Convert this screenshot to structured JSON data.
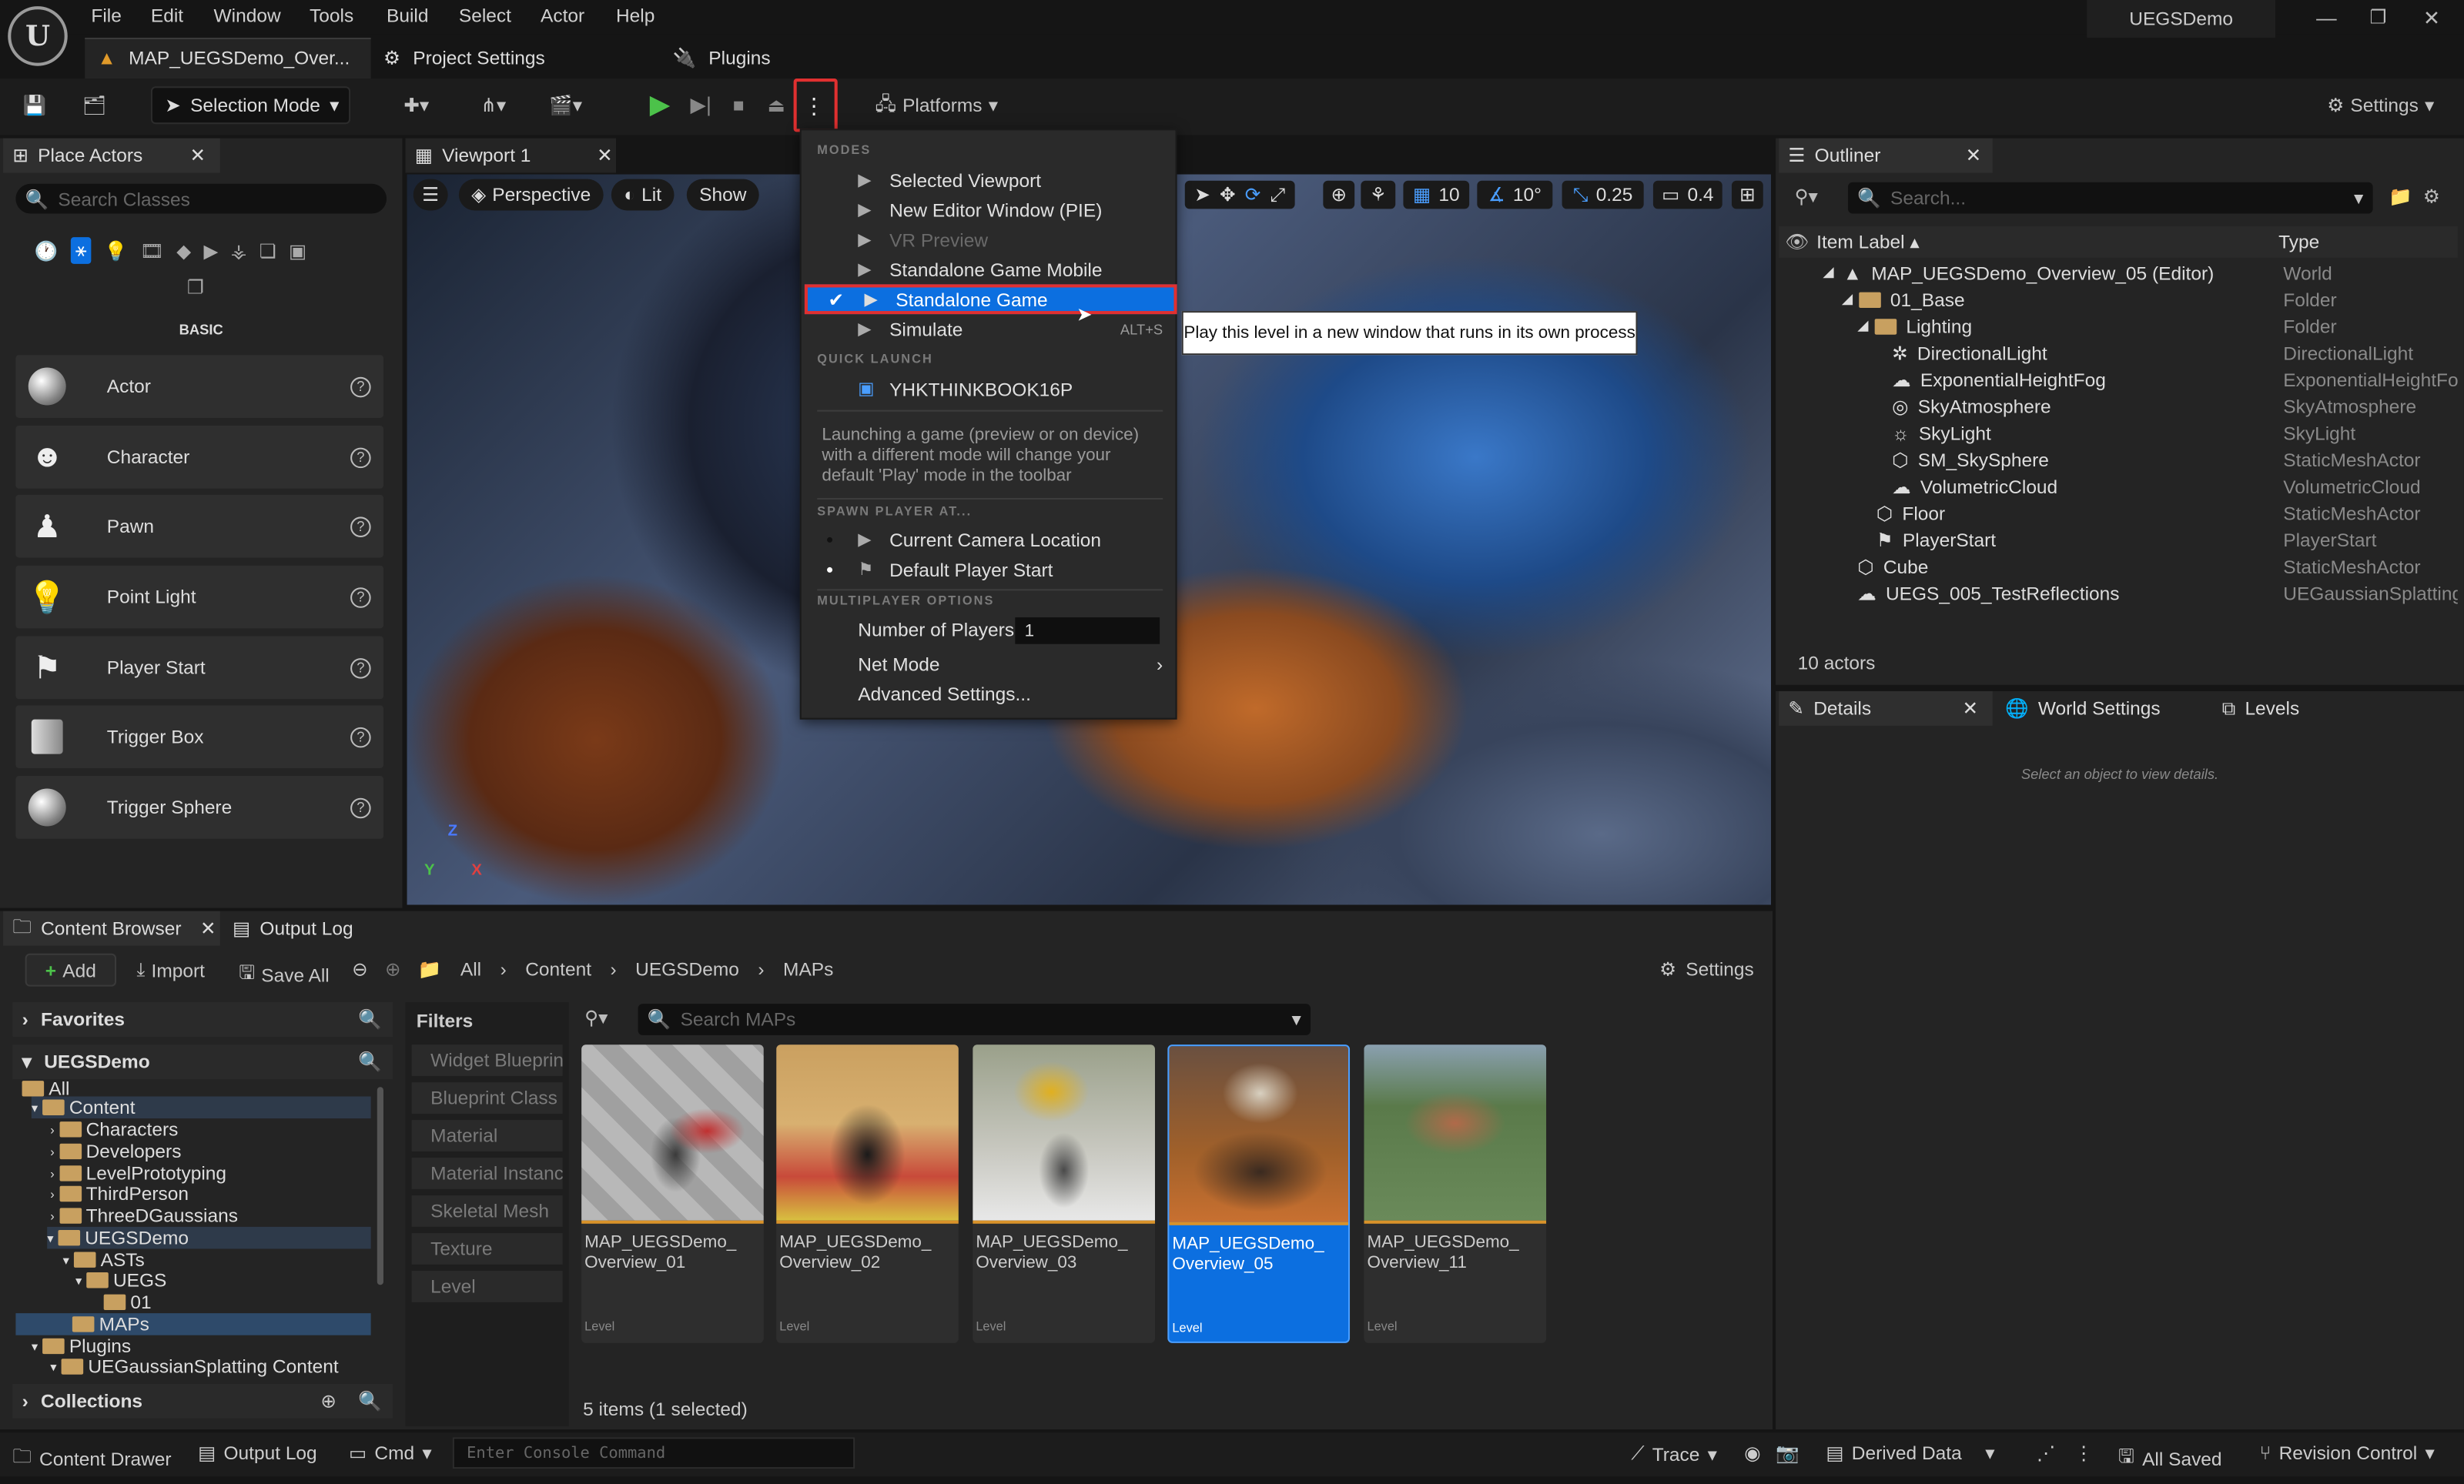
{
  "menubar": {
    "items": [
      "File",
      "Edit",
      "Window",
      "Tools",
      "Build",
      "Select",
      "Actor",
      "Help"
    ],
    "project_name": "UEGSDemo"
  },
  "tabs": {
    "level_tab": "MAP_UEGSDemo_Over...",
    "project_settings": "Project Settings",
    "plugins": "Plugins"
  },
  "toolbar": {
    "selection_mode": "Selection Mode",
    "platforms": "Platforms",
    "settings": "Settings"
  },
  "place_actors": {
    "title": "Place Actors",
    "search_placeholder": "Search Classes",
    "category": "BASIC",
    "items": [
      "Actor",
      "Character",
      "Pawn",
      "Point Light",
      "Player Start",
      "Trigger Box",
      "Trigger Sphere"
    ]
  },
  "viewport": {
    "tab": "Viewport 1",
    "perspective": "Perspective",
    "lit": "Lit",
    "show": "Show",
    "grid_size": "10",
    "rotation_snap": "10°",
    "scale_snap": "0.25",
    "camera_speed": "0.4"
  },
  "play_menu": {
    "modes_header": "MODES",
    "modes": [
      "Selected Viewport",
      "New Editor Window (PIE)",
      "VR Preview",
      "Standalone Game Mobile",
      "Standalone Game",
      "Simulate"
    ],
    "selected_mode": "Standalone Game",
    "simulate_shortcut": "ALT+S",
    "quick_launch_header": "QUICK LAUNCH",
    "device": "YHKTHINKBOOK16P",
    "info": "Launching a game (preview or on device) with a different mode will change your default 'Play' mode in the toolbar",
    "spawn_header": "SPAWN PLAYER AT...",
    "spawn_options": [
      "Current Camera Location",
      "Default Player Start"
    ],
    "multiplayer_header": "MULTIPLAYER OPTIONS",
    "num_players_label": "Number of Players",
    "num_players": "1",
    "net_mode": "Net Mode",
    "advanced": "Advanced Settings..."
  },
  "tooltip": "Play this level in a new window that runs in its own process",
  "outliner": {
    "title": "Outliner",
    "search_placeholder": "Search...",
    "col_label": "Item Label",
    "col_type": "Type",
    "rows": [
      {
        "label": "MAP_UEGSDemo_Overview_05 (Editor)",
        "type": "World"
      },
      {
        "label": "01_Base",
        "type": "Folder"
      },
      {
        "label": "Lighting",
        "type": "Folder"
      },
      {
        "label": "DirectionalLight",
        "type": "DirectionalLight"
      },
      {
        "label": "ExponentialHeightFog",
        "type": "ExponentialHeightFog"
      },
      {
        "label": "SkyAtmosphere",
        "type": "SkyAtmosphere"
      },
      {
        "label": "SkyLight",
        "type": "SkyLight"
      },
      {
        "label": "SM_SkySphere",
        "type": "StaticMeshActor"
      },
      {
        "label": "VolumetricCloud",
        "type": "VolumetricCloud"
      },
      {
        "label": "Floor",
        "type": "StaticMeshActor"
      },
      {
        "label": "PlayerStart",
        "type": "PlayerStart"
      },
      {
        "label": "Cube",
        "type": "StaticMeshActor"
      },
      {
        "label": "UEGS_005_TestReflections",
        "type": "UEGaussianSplatting"
      }
    ],
    "count": "10 actors"
  },
  "details": {
    "tab": "Details",
    "world_settings": "World Settings",
    "levels": "Levels",
    "empty": "Select an object to view details."
  },
  "content_browser": {
    "tab": "Content Browser",
    "output_log_tab": "Output Log",
    "add": "Add",
    "import": "Import",
    "save_all": "Save All",
    "breadcrumb": [
      "All",
      "Content",
      "UEGSDemo",
      "MAPs"
    ],
    "settings": "Settings",
    "favorites": "Favorites",
    "root": "UEGSDemo",
    "tree": [
      "All",
      "Content",
      "Characters",
      "Developers",
      "LevelPrototyping",
      "ThirdPerson",
      "ThreeDGaussians",
      "UEGSDemo",
      "ASTs",
      "UEGS",
      "01",
      "MAPs",
      "Plugins",
      "UEGaussianSplatting Content"
    ],
    "collections": "Collections",
    "filters_title": "Filters",
    "filters": [
      "Widget Blueprint",
      "Blueprint Class",
      "Material",
      "Material Instance",
      "Skeletal Mesh",
      "Texture",
      "Level"
    ],
    "search_placeholder": "Search MAPs",
    "assets": [
      {
        "name": "MAP_UEGSDemo_ Overview_01",
        "type": "Level"
      },
      {
        "name": "MAP_UEGSDemo_ Overview_02",
        "type": "Level"
      },
      {
        "name": "MAP_UEGSDemo_ Overview_03",
        "type": "Level"
      },
      {
        "name": "MAP_UEGSDemo_ Overview_05",
        "type": "Level"
      },
      {
        "name": "MAP_UEGSDemo_ Overview_11",
        "type": "Level"
      }
    ],
    "summary": "5 items (1 selected)"
  },
  "statusbar": {
    "content_drawer": "Content Drawer",
    "output_log": "Output Log",
    "cmd": "Cmd",
    "console_placeholder": "Enter Console Command",
    "trace": "Trace",
    "derived_data": "Derived Data",
    "all_saved": "All Saved",
    "revision_control": "Revision Control"
  },
  "colors": {
    "accent_blue": "#0c6fe0",
    "play_green": "#4cc24a",
    "highlight_red": "#e03030",
    "folder": "#c8a060"
  }
}
